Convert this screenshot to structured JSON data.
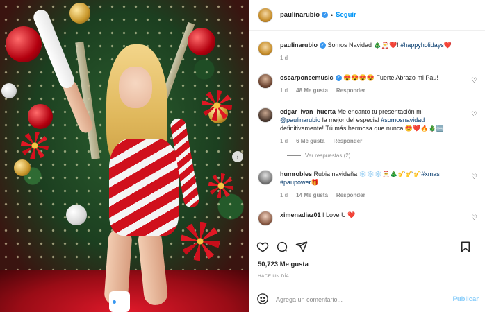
{
  "author": {
    "username": "paulinarubio",
    "follow_label": "Seguir",
    "separator": "•"
  },
  "caption": {
    "username": "paulinarubio",
    "text_before": "Somos Navidad 🎄🎅❤️!",
    "hashtag": "#happyholidays",
    "text_after": "❤️",
    "time": "1 d"
  },
  "comments": [
    {
      "username": "oscarponcemusic",
      "text": "😍😍😍😍 Fuerte Abrazo mi Pau!",
      "time": "1 d",
      "likes": "48 Me gusta",
      "reply": "Responder"
    },
    {
      "username": "edgar_ivan_huerta",
      "text_1": "Me encanto tu presentación mi",
      "mention": "@paulinarubio",
      "text_2": "la mejor del especial",
      "hashtag": "#somosnavidad",
      "text_3": "definitivamente! Tú más hermosa que nunca 😍❤️🔥🎄🆒",
      "time": "1 d",
      "likes": "6 Me gusta",
      "reply": "Responder",
      "replies_label": "Ver respuestas (2)"
    },
    {
      "username": "humrobles",
      "text": "Rubia navideña ❄️❄️❄️🎅🎄🎷🎷🎷",
      "hashtag_1": "#xmas",
      "hashtag_2": "#paupower",
      "text_after": "🎁",
      "time": "1 d",
      "likes": "14 Me gusta",
      "reply": "Responder"
    },
    {
      "username": "ximenadiaz01",
      "text": "I Love U ❤️"
    }
  ],
  "stats": {
    "likes": "50,723 Me gusta",
    "time": "HACE UN DÍA"
  },
  "composer": {
    "placeholder": "Agrega un comentario...",
    "post_label": "Publicar"
  },
  "carousel": {
    "current": 1,
    "total": 2
  },
  "icons": {
    "verified": "verified-badge-icon",
    "like": "heart-icon",
    "comment": "comment-icon",
    "share": "paper-plane-icon",
    "save": "bookmark-icon",
    "emoji": "smiley-icon",
    "next": "chevron-right-icon"
  },
  "colors": {
    "accent": "#0095f6",
    "verified": "#3897f0",
    "hashtag": "#00376b",
    "muted": "#8e8e8e"
  }
}
